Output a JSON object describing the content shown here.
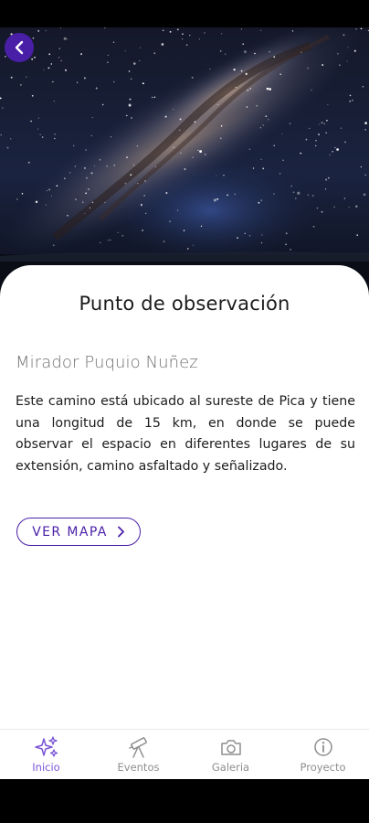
{
  "hero": {
    "image": "milky-way-night-sky"
  },
  "back_button": {
    "icon": "chevron-left-icon"
  },
  "content": {
    "title": "Punto de observación",
    "subtitle": "Mirador Puquio Nuñez",
    "description": "Este camino está ubicado al sureste de Pica y tiene una longitud de 15 km, en donde se puede observar el espacio en diferentes lugares de su extensión, camino asfaltado y señalizado.",
    "map_button_label": "VER MAPA"
  },
  "nav": {
    "items": [
      {
        "label": "Inicio",
        "icon": "sparkles-icon",
        "active": true
      },
      {
        "label": "Eventos",
        "icon": "telescope-icon",
        "active": false
      },
      {
        "label": "Galeria",
        "icon": "camera-icon",
        "active": false
      },
      {
        "label": "Proyecto",
        "icon": "info-icon",
        "active": false
      }
    ]
  },
  "colors": {
    "accent": "#4a1fa8",
    "active_nav": "#7b55d6",
    "inactive_nav": "#8e8e8e",
    "text": "#1c1c1c",
    "subtitle": "#707070"
  }
}
